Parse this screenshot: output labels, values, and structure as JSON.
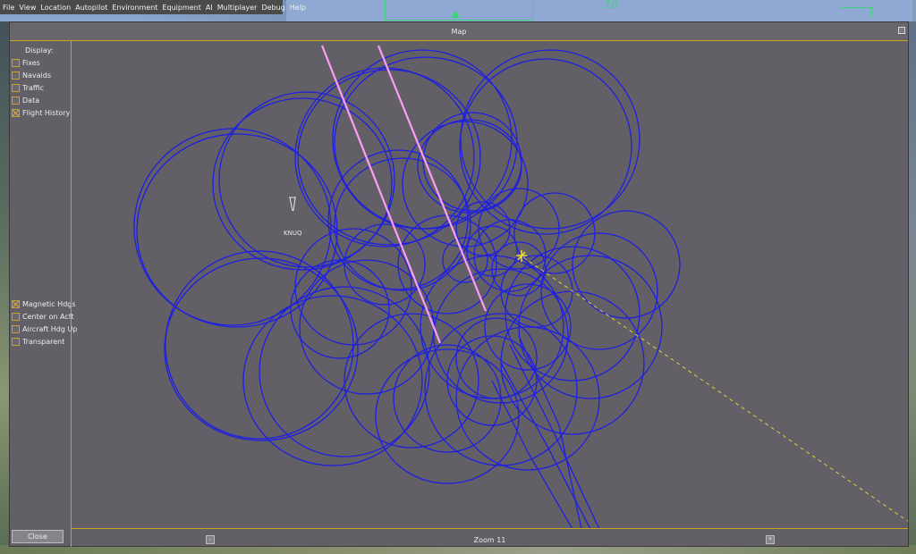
{
  "menu": [
    "File",
    "View",
    "Location",
    "Autopilot",
    "Environment",
    "Equipment",
    "AI",
    "Multiplayer",
    "Debug",
    "Help"
  ],
  "hud": {
    "heading_readout": "10"
  },
  "window": {
    "title": "Map"
  },
  "sidebar": {
    "display_label": "Display:",
    "display_options": [
      {
        "label": "Fixes",
        "checked": false
      },
      {
        "label": "Navaids",
        "checked": false
      },
      {
        "label": "Traffic",
        "checked": false
      },
      {
        "label": "Data",
        "checked": false
      },
      {
        "label": "Flight History",
        "checked": true
      }
    ],
    "view_options": [
      {
        "label": "Magnetic Hdgs",
        "checked": true
      },
      {
        "label": "Center on Acft",
        "checked": false
      },
      {
        "label": "Aircraft Hdg Up",
        "checked": false
      },
      {
        "label": "Transparent",
        "checked": false
      }
    ],
    "close_label": "Close"
  },
  "map": {
    "airport_label": "KNUQ",
    "zoom_label": "Zoom 11",
    "zoom_out_symbol": "-",
    "zoom_in_symbol": "+",
    "colors": {
      "flight_history": "#1f1fe0",
      "runway": "#ff9cf5",
      "aircraft": "#f0e030",
      "heading_line": "#e0d040",
      "panel_border": "#c9a322",
      "background": "#626066"
    }
  }
}
